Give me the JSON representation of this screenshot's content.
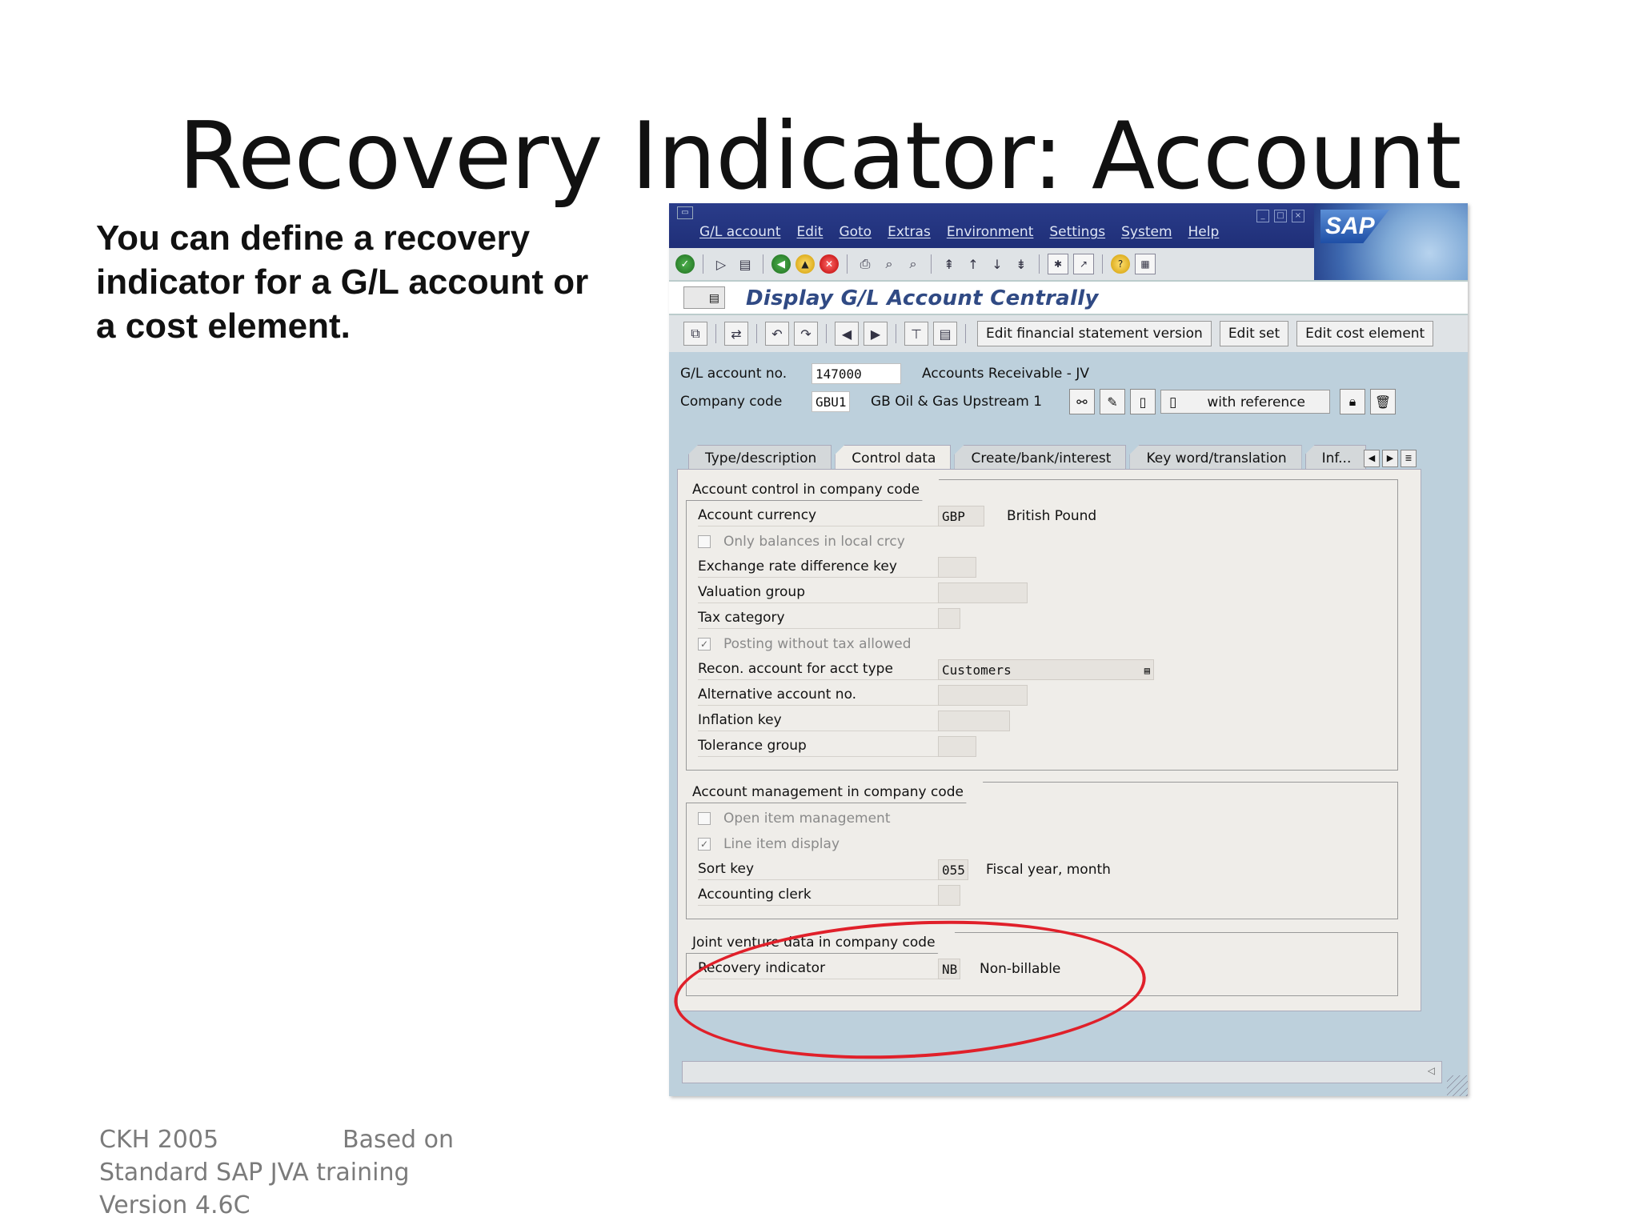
{
  "slide": {
    "title": "Recovery Indicator: Account",
    "intro": "You can define a recovery indicator for a G/L account or a cost element.",
    "footer": {
      "left": "CKH 2005",
      "right": "Based on",
      "line2": "Standard SAP JVA training",
      "line3": "Version 4.6C"
    },
    "highlight_color": "#e0202a"
  },
  "sap": {
    "menu": [
      "G/L account",
      "Edit",
      "Goto",
      "Extras",
      "Environment",
      "Settings",
      "System",
      "Help"
    ],
    "logo_text": "SAP",
    "screen_title": "Display G/L Account Centrally",
    "toolbar_buttons": {
      "edit_fsv": "Edit financial statement version",
      "edit_set": "Edit set",
      "edit_cost_element": "Edit cost element"
    },
    "header": {
      "gl_account_label": "G/L account no.",
      "gl_account_value": "147000",
      "gl_account_desc": "Accounts Receivable - JV",
      "company_code_label": "Company code",
      "company_code_value": "GBU1",
      "company_code_desc": "GB Oil & Gas Upstream 1",
      "with_reference": "with reference"
    },
    "tabs": [
      "Type/description",
      "Control data",
      "Create/bank/interest",
      "Key word/translation",
      "Inf..."
    ],
    "active_tab": "Control data",
    "account_control": {
      "title": "Account control in company code",
      "account_currency_label": "Account currency",
      "account_currency_value": "GBP",
      "account_currency_desc": "British Pound",
      "only_balances_label": "Only balances in local crcy",
      "exchange_rate_label": "Exchange rate difference key",
      "valuation_group_label": "Valuation group",
      "tax_category_label": "Tax category",
      "posting_without_tax_label": "Posting without tax allowed",
      "recon_label": "Recon. account for acct type",
      "recon_value": "Customers",
      "alt_account_label": "Alternative account no.",
      "inflation_key_label": "Inflation key",
      "tolerance_group_label": "Tolerance group"
    },
    "account_management": {
      "title": "Account management in company code",
      "open_item_label": "Open item management",
      "line_item_label": "Line item display",
      "sort_key_label": "Sort key",
      "sort_key_value": "055",
      "sort_key_desc": "Fiscal year, month",
      "accounting_clerk_label": "Accounting clerk"
    },
    "joint_venture": {
      "title": "Joint venture data in company code",
      "recovery_indicator_label": "Recovery indicator",
      "recovery_indicator_value": "NB",
      "recovery_indicator_desc": "Non-billable"
    }
  }
}
